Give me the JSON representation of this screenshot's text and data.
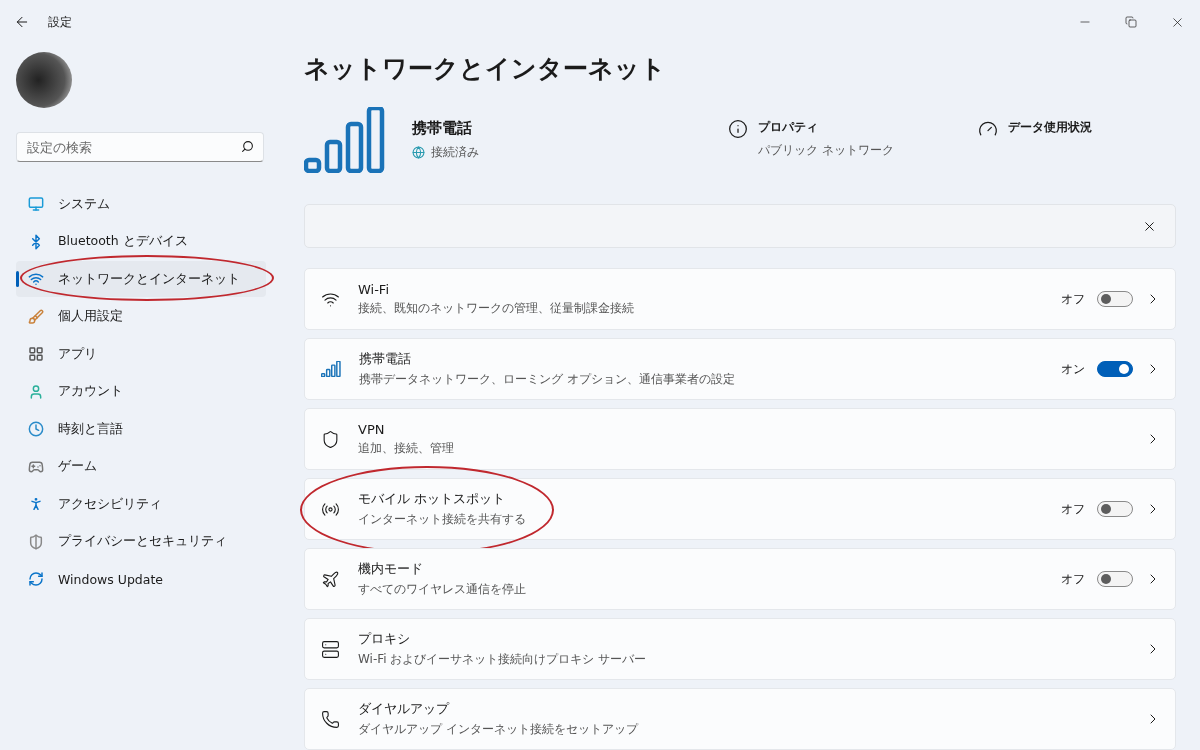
{
  "window": {
    "title": "設定"
  },
  "search": {
    "placeholder": "設定の検索"
  },
  "sidebar": {
    "items": [
      {
        "label": "システム",
        "kind": "system",
        "selected": false,
        "circled": false
      },
      {
        "label": "Bluetooth とデバイス",
        "kind": "bluetooth",
        "selected": false,
        "circled": false
      },
      {
        "label": "ネットワークとインターネット",
        "kind": "network",
        "selected": true,
        "circled": true
      },
      {
        "label": "個人用設定",
        "kind": "brush",
        "selected": false,
        "circled": false
      },
      {
        "label": "アプリ",
        "kind": "apps",
        "selected": false,
        "circled": false
      },
      {
        "label": "アカウント",
        "kind": "account",
        "selected": false,
        "circled": false
      },
      {
        "label": "時刻と言語",
        "kind": "time",
        "selected": false,
        "circled": false
      },
      {
        "label": "ゲーム",
        "kind": "game",
        "selected": false,
        "circled": false
      },
      {
        "label": "アクセシビリティ",
        "kind": "access",
        "selected": false,
        "circled": false
      },
      {
        "label": "プライバシーとセキュリティ",
        "kind": "privacy",
        "selected": false,
        "circled": false
      },
      {
        "label": "Windows Update",
        "kind": "update",
        "selected": false,
        "circled": false
      }
    ]
  },
  "page": {
    "title": "ネットワークとインターネット",
    "connection": {
      "name": "携帯電話",
      "status": "接続済み"
    },
    "properties": {
      "title": "プロパティ",
      "subtitle": "パブリック ネットワーク"
    },
    "data_usage": {
      "title": "データ使用状況"
    }
  },
  "settings": [
    {
      "kind": "wifi",
      "title": "Wi-Fi",
      "subtitle": "接続、既知のネットワークの管理、従量制課金接続",
      "has_toggle": true,
      "on": false,
      "state_label": "オフ",
      "circled": false
    },
    {
      "kind": "cellular",
      "title": "携帯電話",
      "subtitle": "携帯データネットワーク、ローミング オプション、通信事業者の設定",
      "has_toggle": true,
      "on": true,
      "state_label": "オン",
      "circled": false
    },
    {
      "kind": "vpn",
      "title": "VPN",
      "subtitle": "追加、接続、管理",
      "has_toggle": false,
      "circled": false
    },
    {
      "kind": "hotspot",
      "title": "モバイル ホットスポット",
      "subtitle": "インターネット接続を共有する",
      "has_toggle": true,
      "on": false,
      "state_label": "オフ",
      "circled": true
    },
    {
      "kind": "airplane",
      "title": "機内モード",
      "subtitle": "すべてのワイヤレス通信を停止",
      "has_toggle": true,
      "on": false,
      "state_label": "オフ",
      "circled": false
    },
    {
      "kind": "proxy",
      "title": "プロキシ",
      "subtitle": "Wi-Fi およびイーサネット接続向けプロキシ サーバー",
      "has_toggle": false,
      "circled": false
    },
    {
      "kind": "dialup",
      "title": "ダイヤルアップ",
      "subtitle": "ダイヤルアップ インターネット接続をセットアップ",
      "has_toggle": false,
      "circled": false
    }
  ]
}
